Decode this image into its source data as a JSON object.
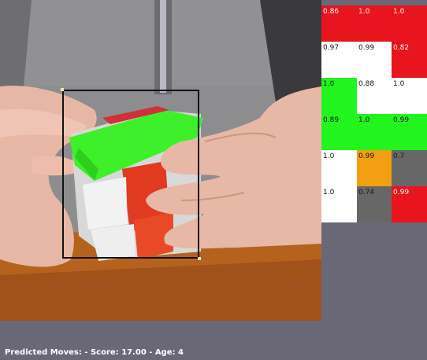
{
  "camera": {
    "description_icon": "camera-feed"
  },
  "face_grid": {
    "rows": [
      [
        {
          "color": "red",
          "confidence": "0.86"
        },
        {
          "color": "red",
          "confidence": "1.0"
        },
        {
          "color": "red",
          "confidence": "1.0"
        }
      ],
      [
        {
          "color": "white",
          "confidence": "0.97"
        },
        {
          "color": "white",
          "confidence": "0.99"
        },
        {
          "color": "red",
          "confidence": "0.82"
        }
      ],
      [
        {
          "color": "green",
          "confidence": "1.0"
        },
        {
          "color": "white",
          "confidence": "0.88"
        },
        {
          "color": "white",
          "confidence": "1.0"
        }
      ],
      [
        {
          "color": "green",
          "confidence": "0.89"
        },
        {
          "color": "green",
          "confidence": "1.0"
        },
        {
          "color": "green",
          "confidence": "0.99"
        }
      ],
      [
        {
          "color": "white",
          "confidence": "1.0"
        },
        {
          "color": "orange",
          "confidence": "0.99"
        },
        {
          "color": "gray",
          "confidence": "0.7"
        }
      ],
      [
        {
          "color": "white",
          "confidence": "1.0"
        },
        {
          "color": "gray",
          "confidence": "0.74"
        },
        {
          "color": "red",
          "confidence": "0.99"
        }
      ]
    ]
  },
  "status": {
    "text": "Predicted Moves:  - Score: 17.00 - Age: 4"
  },
  "colors": {
    "background": "#6a6877",
    "red": "#e8141e",
    "green": "#22f51d",
    "orange": "#f2a012",
    "gray": "#676767",
    "white": "#ffffff"
  }
}
